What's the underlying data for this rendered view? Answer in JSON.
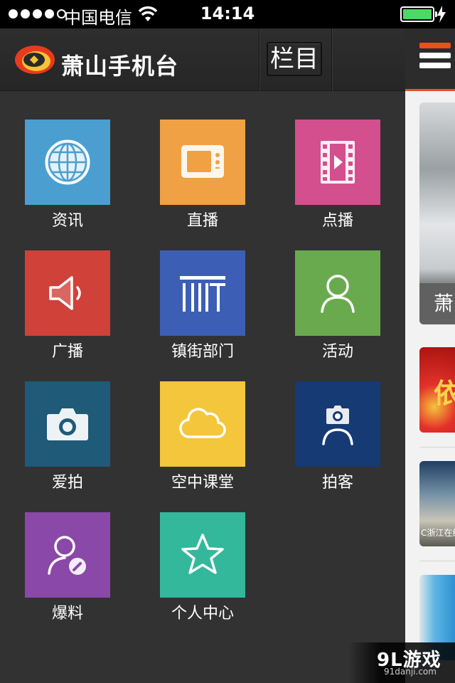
{
  "status_bar": {
    "carrier": "中国电信",
    "time": "14:14",
    "battery_level": 1.0,
    "signal_bars": 4
  },
  "drawer": {
    "brand": "萧山手机台",
    "columns_button": "栏目",
    "items": [
      {
        "label": "资讯",
        "color": "#4a9fd0",
        "icon": "globe-icon"
      },
      {
        "label": "直播",
        "color": "#f0a144",
        "icon": "tv-icon"
      },
      {
        "label": "点播",
        "color": "#d34f8e",
        "icon": "film-icon"
      },
      {
        "label": "广播",
        "color": "#d0413a",
        "icon": "speaker-icon"
      },
      {
        "label": "镇街部门",
        "color": "#3c5fb5",
        "icon": "building-icon"
      },
      {
        "label": "活动",
        "color": "#6aaa4f",
        "icon": "person-icon"
      },
      {
        "label": "爱拍",
        "color": "#1f5a78",
        "icon": "camera-icon"
      },
      {
        "label": "空中课堂",
        "color": "#f3c63c",
        "icon": "cloud-icon"
      },
      {
        "label": "拍客",
        "color": "#153a74",
        "icon": "camera-person-icon"
      },
      {
        "label": "爆料",
        "color": "#8a48a8",
        "icon": "person-edit-icon"
      },
      {
        "label": "个人中心",
        "color": "#33b89c",
        "icon": "star-icon"
      }
    ]
  },
  "content": {
    "menu_colors": [
      "#e8501c",
      "#ffffff",
      "#ffffff"
    ],
    "featured_caption": "萧",
    "thumb1_text": "依",
    "thumb2_text": "C浙江在线"
  },
  "watermark": {
    "main": "9L游戏",
    "sub": "91danji.com"
  },
  "colors": {
    "accent": "#e8501c",
    "drawer_bg": "#323232"
  }
}
